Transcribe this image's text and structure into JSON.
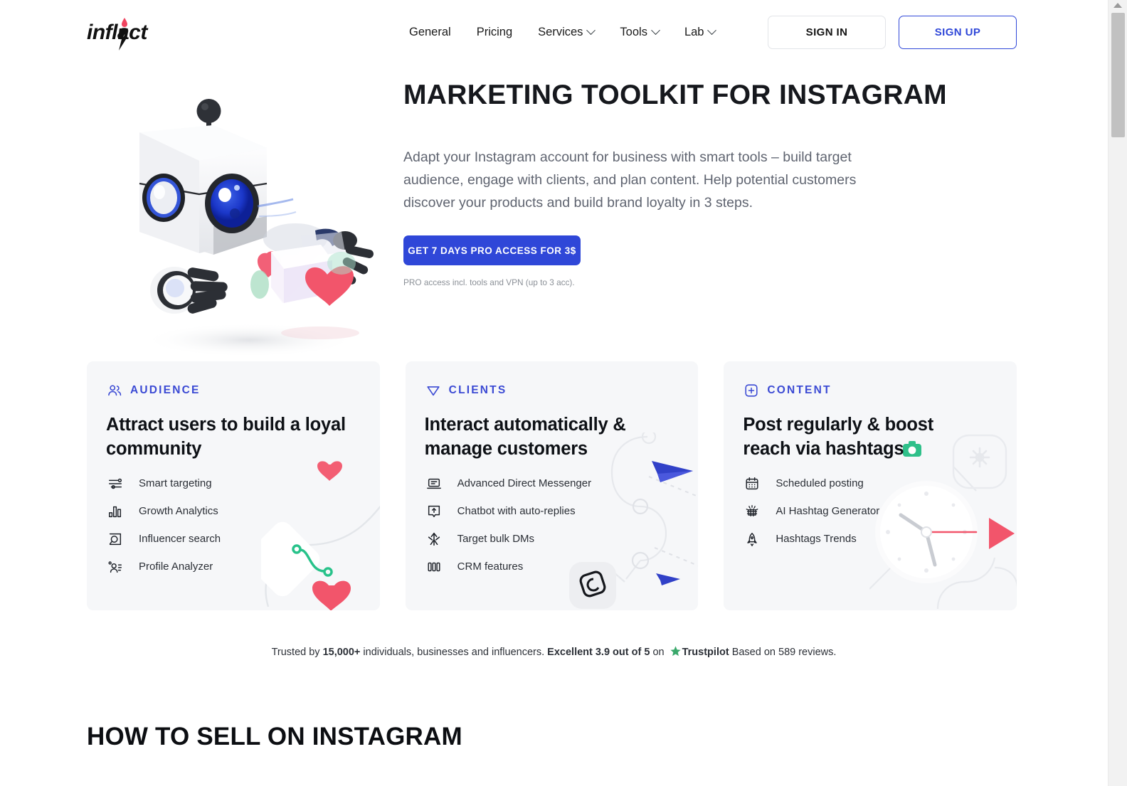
{
  "header": {
    "logo_text": "inflact",
    "logo_icon": "lightning-drop-icon",
    "nav": [
      {
        "label": "General",
        "has_dropdown": false
      },
      {
        "label": "Pricing",
        "has_dropdown": false
      },
      {
        "label": "Services",
        "has_dropdown": true
      },
      {
        "label": "Tools",
        "has_dropdown": true
      },
      {
        "label": "Lab",
        "has_dropdown": true
      }
    ],
    "sign_in": "SIGN IN",
    "sign_up": "SIGN UP"
  },
  "hero": {
    "title": "MARKETING TOOLKIT FOR INSTAGRAM",
    "description": "Adapt your Instagram account for business with smart tools – build target audience, engage with clients, and plan content. Help potential customers discover your products and build brand loyalty in 3 steps.",
    "cta_label": "GET 7 DAYS PRO ACCESS FOR 3$",
    "cta_note": "PRO access incl. tools and VPN (up to 3 acc).",
    "illustration": "robot-3d-illustration"
  },
  "cards": [
    {
      "kicker": "AUDIENCE",
      "kicker_icon": "users-icon",
      "title": "Attract users to build a loyal community",
      "items": [
        {
          "label": "Smart targeting",
          "icon": "sliders-icon"
        },
        {
          "label": "Growth Analytics",
          "icon": "bar-chart-icon"
        },
        {
          "label": "Influencer search",
          "icon": "search-box-icon"
        },
        {
          "label": "Profile Analyzer",
          "icon": "user-list-icon"
        }
      ]
    },
    {
      "kicker": "CLIENTS",
      "kicker_icon": "send-plane-icon",
      "title": "Interact automatically & manage customers",
      "items": [
        {
          "label": "Advanced Direct Messenger",
          "icon": "laptop-message-icon"
        },
        {
          "label": "Chatbot with auto-replies",
          "icon": "chatbot-icon"
        },
        {
          "label": "Target bulk DMs",
          "icon": "target-arrows-icon"
        },
        {
          "label": "CRM features",
          "icon": "columns-icon"
        }
      ]
    },
    {
      "kicker": "CONTENT",
      "kicker_icon": "plus-square-icon",
      "title": "Post regularly & boost reach via hashtags",
      "items": [
        {
          "label": "Scheduled posting",
          "icon": "calendar-icon"
        },
        {
          "label": "AI Hashtag Generator",
          "icon": "hashtag-gear-icon"
        },
        {
          "label": "Hashtags Trends",
          "icon": "rocket-icon"
        }
      ]
    }
  ],
  "trust": {
    "prefix": "Trusted by ",
    "count": "15,000+",
    "middle": " individuals, businesses and influencers. ",
    "rating": "Excellent 3.9 out of 5",
    "on": " on ",
    "brand": "Trustpilot",
    "suffix": " Based on 589 reviews."
  },
  "section": {
    "title": "HOW TO SELL ON INSTAGRAM",
    "subtitle": ""
  },
  "colors": {
    "accent_blue": "#2f47d8",
    "kicker_blue": "#3b4ad4",
    "heart_pink": "#f2556b",
    "green": "#2fc08a",
    "card_bg": "#f6f7f9",
    "text_dark": "#0e1116",
    "text_muted": "#5f6470",
    "trustpilot_green": "#3aa86b"
  },
  "scrollbar": {
    "position": "right",
    "thumb_top_pct": 2,
    "thumb_height_pct": 16
  }
}
